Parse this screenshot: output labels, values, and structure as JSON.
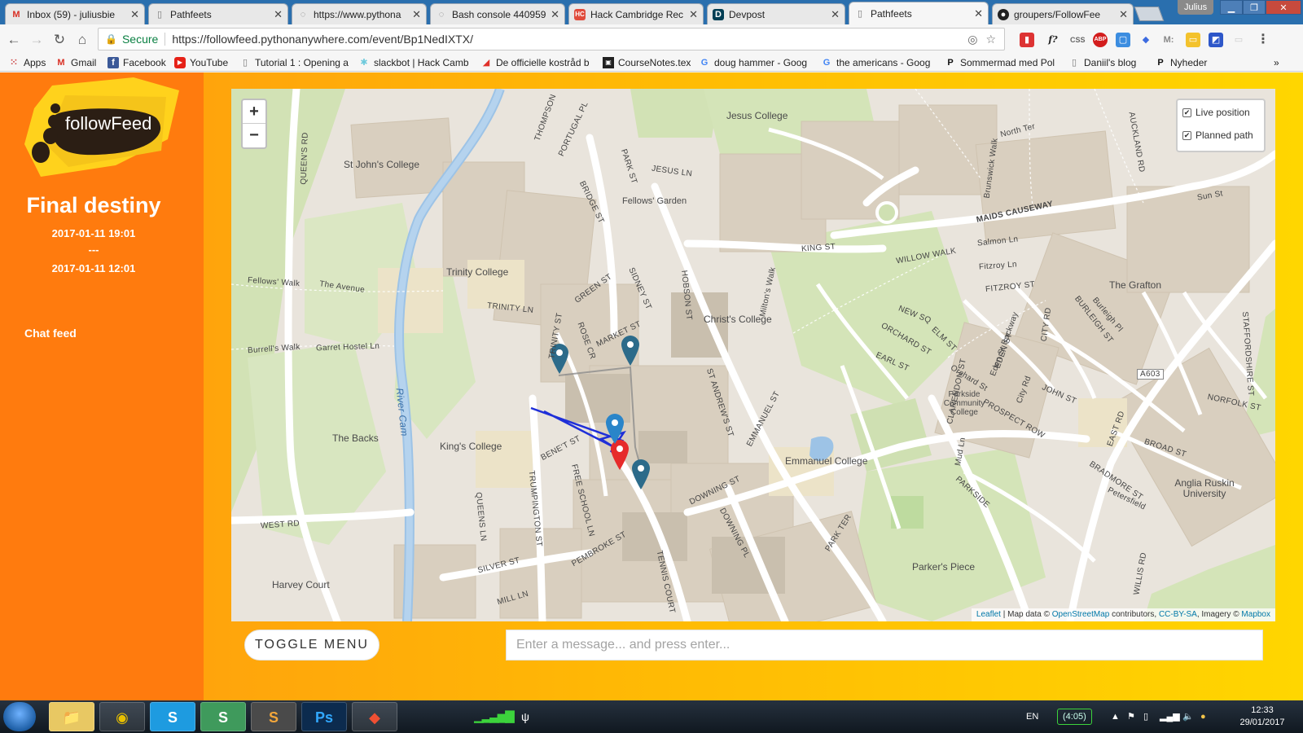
{
  "browser": {
    "tabs": [
      {
        "title": "Inbox (59) - juliusbie",
        "icon": "gmail-icon",
        "color": "#d93025"
      },
      {
        "title": "Pathfeets",
        "icon": "document-icon",
        "color": "#777777"
      },
      {
        "title": "https://www.pythona",
        "icon": "loading-icon",
        "color": "#777777"
      },
      {
        "title": "Bash console 440959",
        "icon": "loading-icon",
        "color": "#777777"
      },
      {
        "title": "Hack Cambridge Rec",
        "icon": "hack-cambridge-icon",
        "color": "#e04b3b"
      },
      {
        "title": "Devpost",
        "icon": "devpost-icon",
        "color": "#003e54"
      },
      {
        "title": "Pathfeets",
        "icon": "document-icon",
        "color": "#777777"
      },
      {
        "title": "groupers/FollowFee",
        "icon": "github-icon",
        "color": "#222222"
      }
    ],
    "profile": "Julius",
    "address": {
      "secure_label": "Secure",
      "url": "https://followfeed.pythonanywhere.com/event/Bp1NedIXTX/"
    },
    "bookmarks": [
      {
        "label": "Apps",
        "icon": "apps-grid-icon",
        "color": "#555555"
      },
      {
        "label": "Gmail",
        "icon": "gmail-icon",
        "color": "#d93025"
      },
      {
        "label": "Facebook",
        "icon": "facebook-icon",
        "color": "#3b5998"
      },
      {
        "label": "YouTube",
        "icon": "youtube-icon",
        "color": "#e62117"
      },
      {
        "label": "Tutorial 1 : Opening a",
        "icon": "document-icon",
        "color": "#777777"
      },
      {
        "label": "slackbot | Hack Camb",
        "icon": "slack-icon",
        "color": "#6ecadc"
      },
      {
        "label": "De officielle kostråd b",
        "icon": "carrot-icon",
        "color": "#e0312a"
      },
      {
        "label": "CourseNotes.tex",
        "icon": "overleaf-icon",
        "color": "#222222"
      },
      {
        "label": "doug hammer - Goog",
        "icon": "google-icon",
        "color": "#4285f4"
      },
      {
        "label": "the americans - Goog",
        "icon": "google-icon",
        "color": "#4285f4"
      },
      {
        "label": "Sommermad med Pol",
        "icon": "p-icon",
        "color": "#111111"
      },
      {
        "label": "Daniil's blog",
        "icon": "document-icon",
        "color": "#777777"
      },
      {
        "label": "Nyheder",
        "icon": "p-icon",
        "color": "#111111"
      }
    ]
  },
  "sidebar": {
    "logo_text": "followFeed",
    "event_title": "Final destiny",
    "date_start": "2017-01-11 19:01",
    "date_sep": "---",
    "date_end": "2017-01-11 12:01",
    "chat_feed": "Chat feed"
  },
  "map": {
    "zoom_in": "+",
    "zoom_out": "−",
    "layers": {
      "live_position": "Live position",
      "planned_path": "Planned path"
    },
    "attribution": {
      "leaflet": "Leaflet",
      "mapdata": "| Map data ©",
      "osm": "OpenStreetMap",
      "contrib": "contributors,",
      "cc": "CC-BY-SA",
      "imagery": ", Imagery ©",
      "mapbox": "Mapbox"
    },
    "places": [
      "Jesus College",
      "St John's College",
      "Trinity College",
      "Christ's College",
      "King's College",
      "The Backs",
      "Emmanuel College",
      "Parker's Piece",
      "Harvey Court",
      "The Grafton",
      "Anglia Ruskin University",
      "Parkside Community College",
      "Fellows' Garden"
    ],
    "streets": [
      "QUEEN'S RD",
      "THOMPSON",
      "PORTUGAL PL",
      "PARK ST",
      "JESUS LN",
      "BRIDGE ST",
      "GREEN ST",
      "SIDNEY ST",
      "HOBSON ST",
      "TRINITY LN",
      "MARKET ST",
      "TRINITY ST",
      "ROSE CR",
      "KING ST",
      "MAIDS CAUSEWAY",
      "WILLOW WALK",
      "FITZROY ST",
      "NEW SQ",
      "ORCHARD ST",
      "EARL ST",
      "ELM ST",
      "BENE'T ST",
      "TRUMPINGTON ST",
      "FREE SCHOOL LN",
      "DOWNING ST",
      "DOWNING PL",
      "ST ANDREW'S ST",
      "EMMANUEL ST",
      "PEMBROKE ST",
      "SILVER ST",
      "MILL LN",
      "TENNIS COURT",
      "WEST RD",
      "PARKSIDE",
      "PARK TER",
      "PROSPECT ROW",
      "JOHN ST",
      "CITY RD",
      "BURLEIGH ST",
      "NORFOLK ST",
      "BROAD ST",
      "EAST RD",
      "BRADMORE ST",
      "A603",
      "STAFFORDSHIRE ST",
      "CLARENDON ST",
      "QUEENS LN",
      "WILLIS RD",
      "River Cam",
      "Fellows' Walk",
      "The Avenue",
      "Burrell's Walk",
      "Garret Hostel Ln",
      "North Ter",
      "Sun St",
      "Salmon Ln",
      "Fitzroy Ln",
      "AUCKLAND RD",
      "Brunswick Walk",
      "Milton's Walk",
      "Orchard St",
      "Eden St Backway",
      "EDEN ST",
      "Mud Ln",
      "City Rd",
      "Burleigh Pl",
      "Petersfield"
    ],
    "marker_color": "#2c6b8a",
    "live_marker_color": "#e62b2b",
    "path_color": "#1f2fd8"
  },
  "footer": {
    "toggle_menu": "TOGGLE MENU",
    "message_placeholder": "Enter a message... and press enter..."
  },
  "taskbar": {
    "apps": [
      {
        "icon": "file-explorer-icon",
        "label": "📁"
      },
      {
        "icon": "chrome-icon",
        "label": "◉"
      },
      {
        "icon": "skype-icon",
        "label": "S"
      },
      {
        "icon": "slack-icon",
        "label": "S"
      },
      {
        "icon": "sublime-text-icon",
        "label": "S"
      },
      {
        "icon": "photoshop-icon",
        "label": "Ps"
      },
      {
        "icon": "git-icon",
        "label": "◆"
      }
    ],
    "language": "EN",
    "battery": "(4:05)",
    "time": "12:33",
    "date": "29/01/2017"
  }
}
